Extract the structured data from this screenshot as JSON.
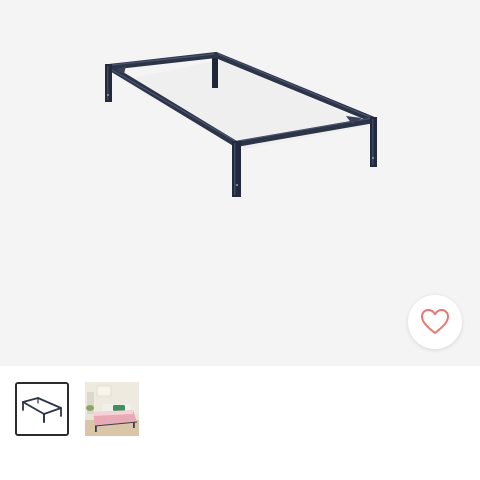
{
  "product_gallery": {
    "main_image": "bed-frame-icon",
    "favorite_button": {
      "icon": "heart-outline-icon",
      "color": "#e47a72"
    },
    "thumbnails": [
      {
        "icon": "bed-frame-icon",
        "selected": true
      },
      {
        "icon": "bedroom-photo-icon",
        "selected": false
      }
    ]
  },
  "colors": {
    "frame": "#2c3448",
    "background": "#f4f4f4",
    "accent": "#e47a72"
  }
}
